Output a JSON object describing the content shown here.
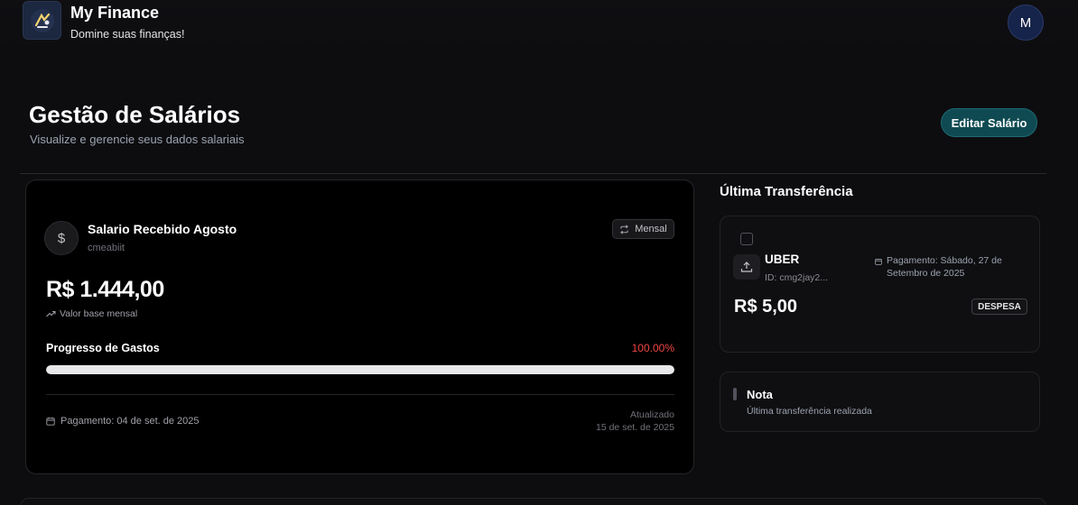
{
  "header": {
    "app_title": "My Finance",
    "app_subtitle": "Domine suas finanças!",
    "avatar_initial": "M"
  },
  "page": {
    "title": "Gestão de Salários",
    "subtitle": "Visualize e gerencie seus dados salariais",
    "edit_button": "Editar Salário"
  },
  "salary_card": {
    "currency_icon": "dollar-icon",
    "title": "Salario Recebido Agosto",
    "subtitle": "cmeabiit",
    "frequency_badge": "Mensal",
    "amount": "R$ 1.444,00",
    "amount_label": "Valor base mensal",
    "progress_label": "Progresso de Gastos",
    "progress_percent_text": "100.00%",
    "progress_fraction": 1.0,
    "payment_date": "Pagamento: 04 de set. de 2025",
    "updated_label": "Atualizado",
    "updated_date": "15 de set. de 2025"
  },
  "last_transfer": {
    "section_title": "Última Transferência",
    "merchant": "UBER",
    "id": "ID: cmg2jay2...",
    "payment": "Pagamento: Sábado, 27 de Setembro de 2025",
    "amount": "R$ 5,00",
    "type_badge": "DESPESA"
  },
  "note": {
    "title": "Nota",
    "text": "Última transferência realizada"
  },
  "colors": {
    "accent_button": "#0f4a52",
    "progress_over": "#ef4444",
    "background": "#0d0d10"
  }
}
